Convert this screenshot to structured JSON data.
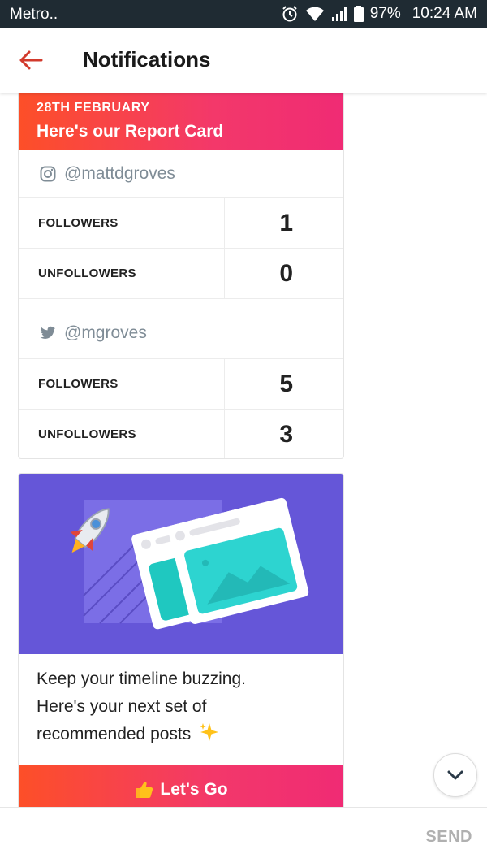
{
  "status_bar": {
    "carrier": "Metro..",
    "battery": "97%",
    "time": "10:24 AM"
  },
  "app_bar": {
    "title": "Notifications"
  },
  "report_card": {
    "date": "28TH FEBRUARY",
    "headline": "Here's our Report Card",
    "accounts": [
      {
        "network_icon": "instagram-icon",
        "handle": "@mattdgroves",
        "stats": [
          {
            "label": "FOLLOWERS",
            "value": "1"
          },
          {
            "label": "UNFOLLOWERS",
            "value": "0"
          }
        ]
      },
      {
        "network_icon": "twitter-icon",
        "handle": "@mgroves",
        "stats": [
          {
            "label": "FOLLOWERS",
            "value": "5"
          },
          {
            "label": "UNFOLLOWERS",
            "value": "3"
          }
        ]
      }
    ]
  },
  "promo_card": {
    "line1": "Keep your timeline buzzing.",
    "line2": "Here's your next set of",
    "line3": "recommended posts",
    "cta_label": "Let's Go"
  },
  "composer": {
    "send_label": "SEND"
  },
  "colors": {
    "accent_start": "#fd4f28",
    "accent_end": "#f02b74",
    "promo_bg": "#6556d8",
    "back_arrow": "#d23a2c"
  }
}
